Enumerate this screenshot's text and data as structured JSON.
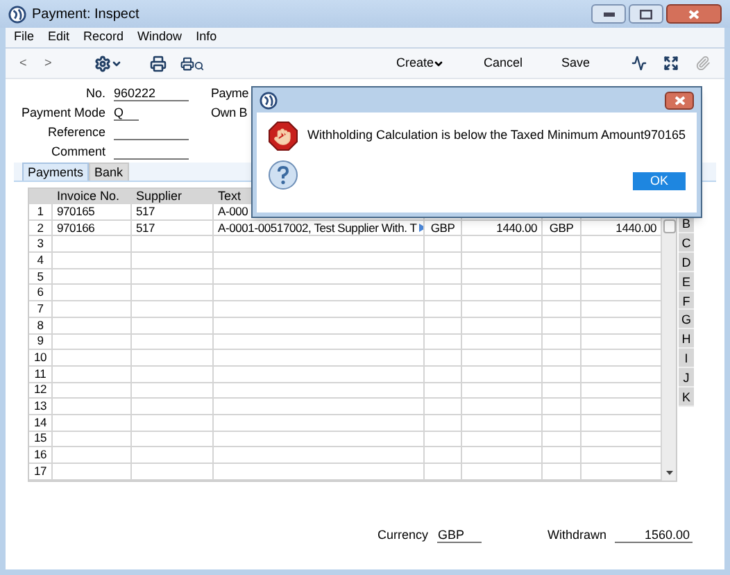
{
  "window": {
    "title": "Payment: Inspect"
  },
  "menu": [
    "File",
    "Edit",
    "Record",
    "Window",
    "Info"
  ],
  "toolbar": {
    "nav": [
      "<",
      ">"
    ],
    "buttons": [
      {
        "label": "Create",
        "dropdown": true
      },
      {
        "label": "Cancel",
        "dropdown": false
      },
      {
        "label": "Save",
        "dropdown": false
      }
    ]
  },
  "form": {
    "left": [
      {
        "label": "No.",
        "value": "960222"
      },
      {
        "label": "Payment Mode",
        "value": "Q"
      },
      {
        "label": "Reference"
      },
      {
        "label": "Comment"
      }
    ],
    "right": [
      "Payme",
      "Own B"
    ]
  },
  "tabs": [
    {
      "label": "Payments",
      "selected": true
    },
    {
      "label": "Bank",
      "selected": false
    }
  ],
  "table": {
    "columns": [
      "Invoice No.",
      "Supplier",
      "Text"
    ],
    "rows": [
      {
        "number": "1",
        "cells": [
          "970165",
          "517",
          "A-000"
        ]
      },
      {
        "number": "2",
        "cells": [
          "970166",
          "517",
          "A-0001-00517002, Test Supplier With. T",
          "GBP",
          "1440.00",
          "GBP",
          "1440.00"
        ],
        "more": true
      },
      {
        "number": "3"
      },
      {
        "number": "4"
      },
      {
        "number": "5"
      },
      {
        "number": "6"
      },
      {
        "number": "7"
      },
      {
        "number": "8"
      },
      {
        "number": "9"
      },
      {
        "number": "10"
      },
      {
        "number": "11"
      },
      {
        "number": "12"
      },
      {
        "number": "13"
      },
      {
        "number": "14"
      },
      {
        "number": "15"
      },
      {
        "number": "16"
      },
      {
        "number": "17"
      }
    ],
    "side_tabs": [
      "B",
      "C",
      "D",
      "E",
      "F",
      "G",
      "H",
      "I",
      "J",
      "K"
    ]
  },
  "footer": [
    {
      "label": "Currency",
      "value": "GBP"
    },
    {
      "label": "Withdrawn",
      "value": "1560.00"
    }
  ],
  "dialog": {
    "message": "Withholding Calculation is below the Taxed Minimum Amount970165",
    "button": "OK"
  }
}
